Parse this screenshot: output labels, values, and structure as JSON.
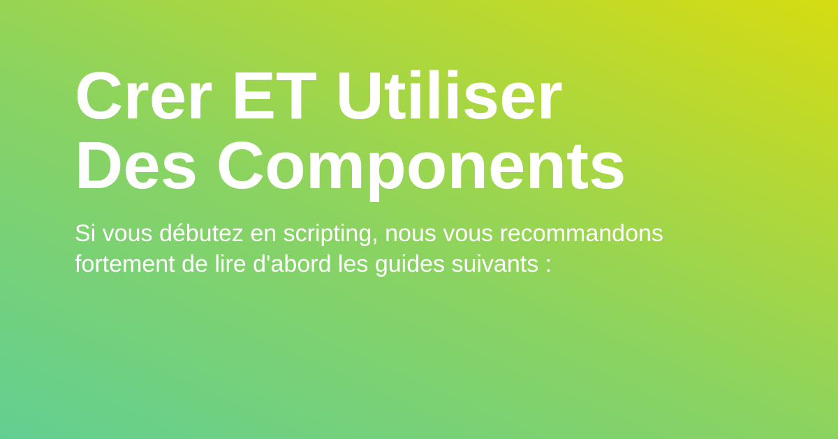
{
  "card": {
    "title_lines": [
      "Crer ET Utiliser",
      "Des Components"
    ],
    "description_lines": [
      "Si vous débutez en scripting, nous vous recommandons",
      "fortement de lire d'abord les guides suivants :"
    ]
  },
  "colors": {
    "gradient_start": "#62cf92",
    "gradient_middle": "#8ad361",
    "gradient_end": "#d6dc12",
    "text": "#ffffff"
  }
}
